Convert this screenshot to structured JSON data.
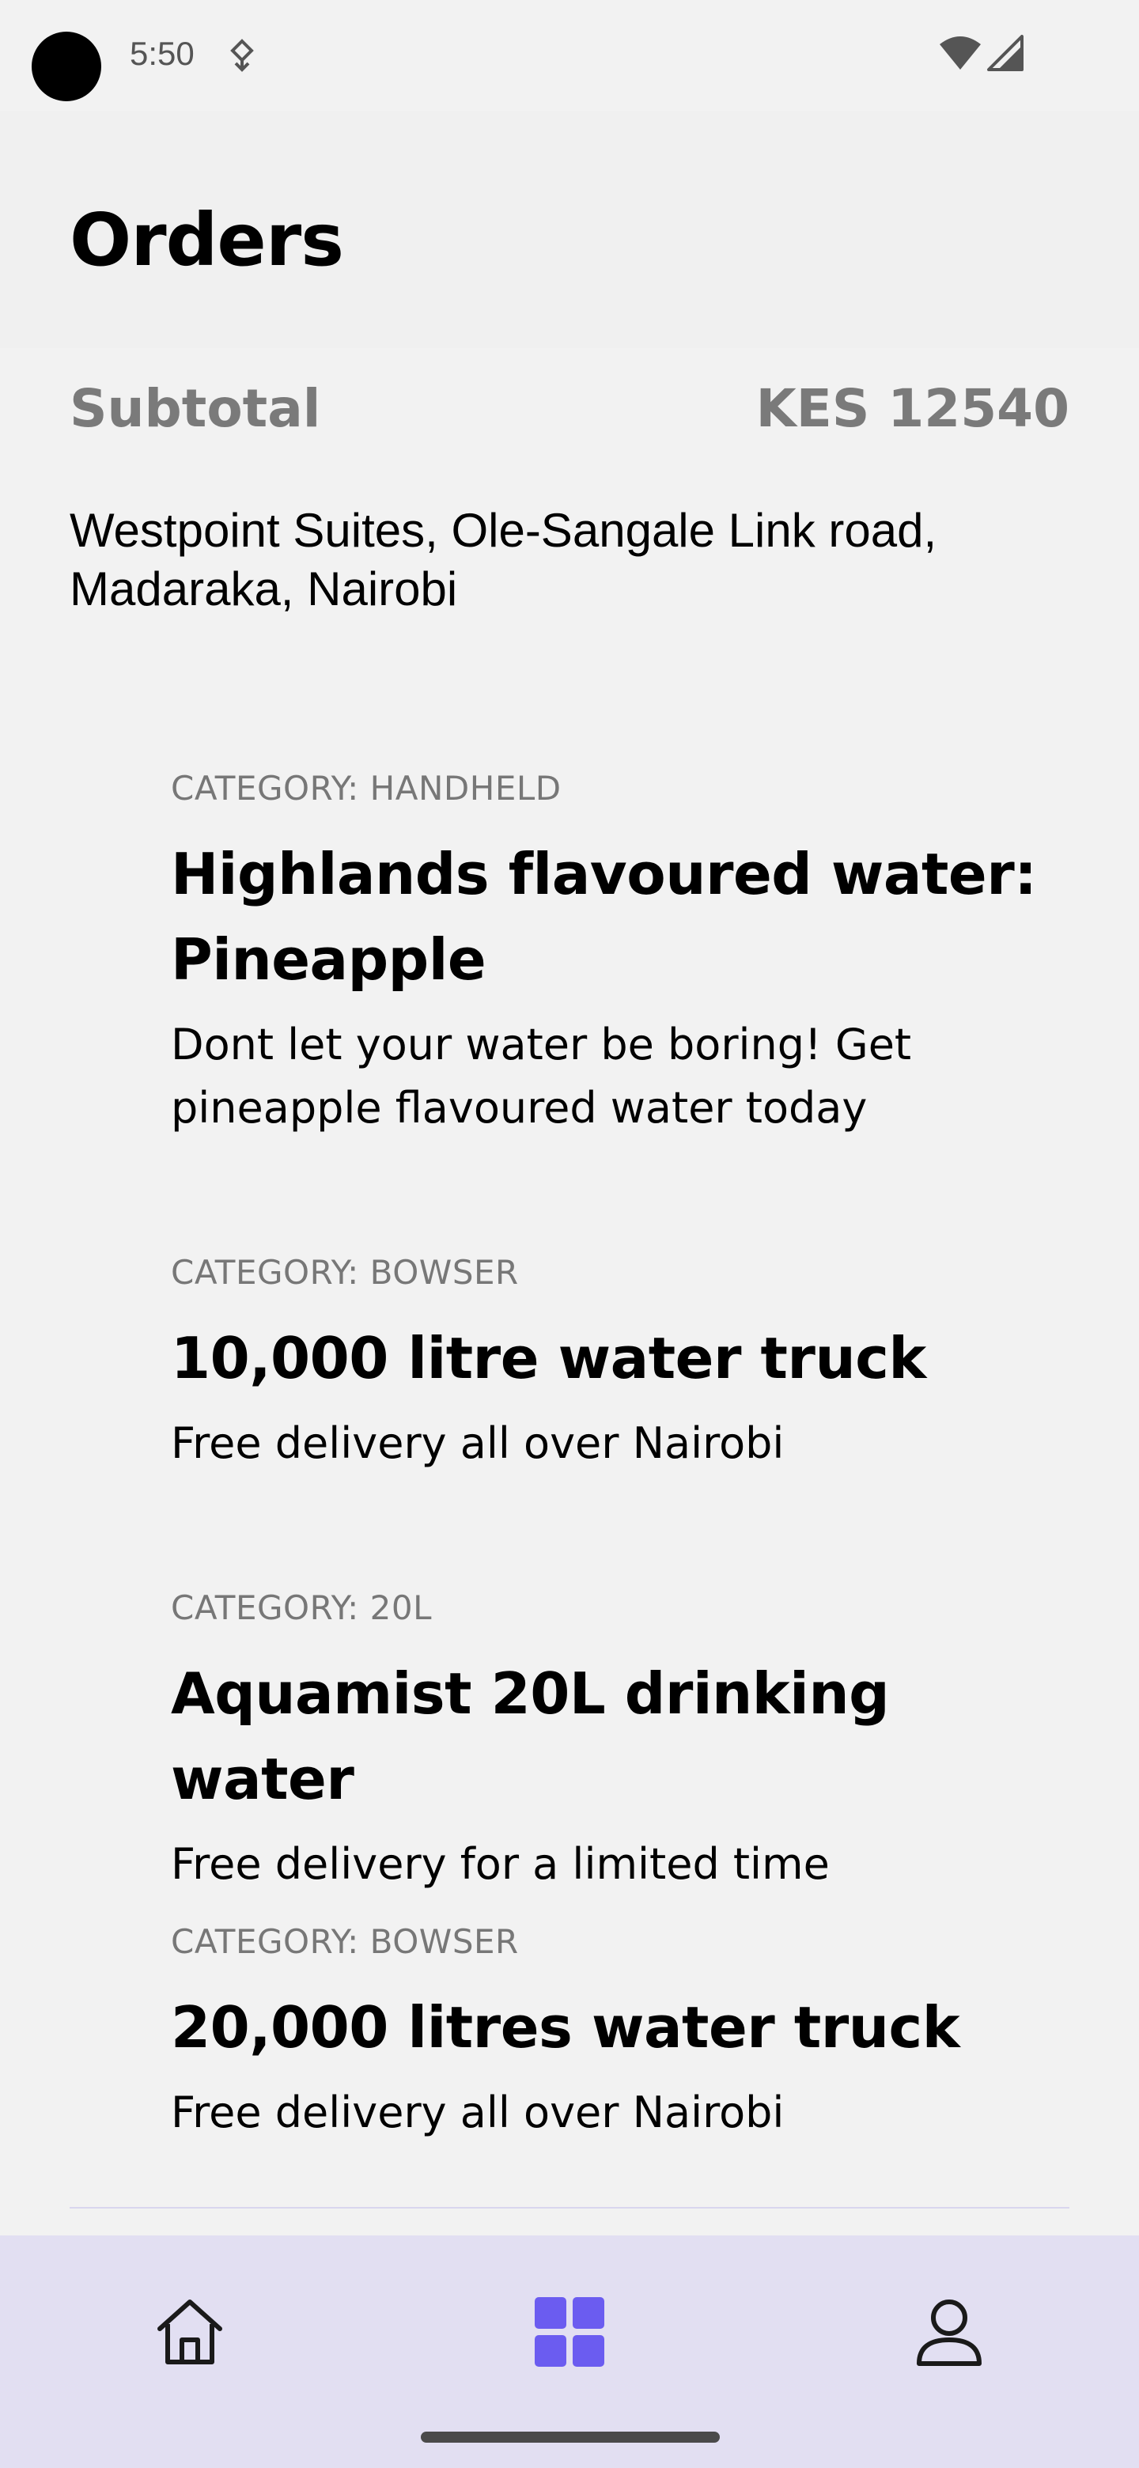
{
  "status_bar": {
    "time": "5:50"
  },
  "header": {
    "title": "Orders"
  },
  "summary": {
    "subtotal_label": "Subtotal",
    "subtotal_value": "KES 12540",
    "address_line1": "Westpoint Suites, Ole-Sangale Link road,",
    "address_line2": "Madaraka, Nairobi"
  },
  "orders": [
    {
      "category": "CATEGORY: HANDHELD",
      "title_line1": "Highlands flavoured water:",
      "title_line2": "Pineapple",
      "desc_line1": "Dont let your water be boring! Get",
      "desc_line2": "pineapple flavoured water today"
    },
    {
      "category": "CATEGORY: BOWSER",
      "title": "10,000 litre water truck",
      "desc": "Free delivery all over Nairobi"
    },
    {
      "category": "CATEGORY: 20L",
      "title": "Aquamist 20L drinking water",
      "desc": "Free delivery for a limited time"
    },
    {
      "category": "CATEGORY: BOWSER",
      "title": "20,000 litres water truck",
      "desc": "Free delivery all over Nairobi"
    }
  ],
  "bottom_nav": {
    "items": [
      {
        "icon": "home-icon",
        "active": false
      },
      {
        "icon": "grid-icon",
        "active": true
      },
      {
        "icon": "person-icon",
        "active": false
      }
    ],
    "active_color": "#6b5cf0",
    "inactive_color": "#1a1a1a",
    "background": "#e2dff2"
  }
}
